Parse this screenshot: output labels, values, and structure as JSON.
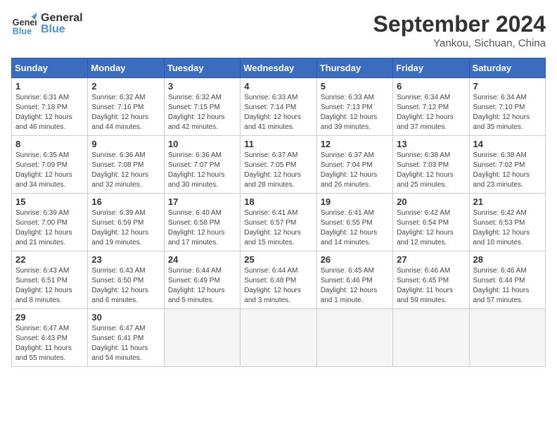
{
  "header": {
    "logo_general": "General",
    "logo_blue": "Blue",
    "month_title": "September 2024",
    "location": "Yankou, Sichuan, China"
  },
  "weekdays": [
    "Sunday",
    "Monday",
    "Tuesday",
    "Wednesday",
    "Thursday",
    "Friday",
    "Saturday"
  ],
  "weeks": [
    [
      {
        "day": "1",
        "info": "Sunrise: 6:31 AM\nSunset: 7:18 PM\nDaylight: 12 hours\nand 46 minutes."
      },
      {
        "day": "2",
        "info": "Sunrise: 6:32 AM\nSunset: 7:16 PM\nDaylight: 12 hours\nand 44 minutes."
      },
      {
        "day": "3",
        "info": "Sunrise: 6:32 AM\nSunset: 7:15 PM\nDaylight: 12 hours\nand 42 minutes."
      },
      {
        "day": "4",
        "info": "Sunrise: 6:33 AM\nSunset: 7:14 PM\nDaylight: 12 hours\nand 41 minutes."
      },
      {
        "day": "5",
        "info": "Sunrise: 6:33 AM\nSunset: 7:13 PM\nDaylight: 12 hours\nand 39 minutes."
      },
      {
        "day": "6",
        "info": "Sunrise: 6:34 AM\nSunset: 7:12 PM\nDaylight: 12 hours\nand 37 minutes."
      },
      {
        "day": "7",
        "info": "Sunrise: 6:34 AM\nSunset: 7:10 PM\nDaylight: 12 hours\nand 35 minutes."
      }
    ],
    [
      {
        "day": "8",
        "info": "Sunrise: 6:35 AM\nSunset: 7:09 PM\nDaylight: 12 hours\nand 34 minutes."
      },
      {
        "day": "9",
        "info": "Sunrise: 6:36 AM\nSunset: 7:08 PM\nDaylight: 12 hours\nand 32 minutes."
      },
      {
        "day": "10",
        "info": "Sunrise: 6:36 AM\nSunset: 7:07 PM\nDaylight: 12 hours\nand 30 minutes."
      },
      {
        "day": "11",
        "info": "Sunrise: 6:37 AM\nSunset: 7:05 PM\nDaylight: 12 hours\nand 28 minutes."
      },
      {
        "day": "12",
        "info": "Sunrise: 6:37 AM\nSunset: 7:04 PM\nDaylight: 12 hours\nand 26 minutes."
      },
      {
        "day": "13",
        "info": "Sunrise: 6:38 AM\nSunset: 7:03 PM\nDaylight: 12 hours\nand 25 minutes."
      },
      {
        "day": "14",
        "info": "Sunrise: 6:38 AM\nSunset: 7:02 PM\nDaylight: 12 hours\nand 23 minutes."
      }
    ],
    [
      {
        "day": "15",
        "info": "Sunrise: 6:39 AM\nSunset: 7:00 PM\nDaylight: 12 hours\nand 21 minutes."
      },
      {
        "day": "16",
        "info": "Sunrise: 6:39 AM\nSunset: 6:59 PM\nDaylight: 12 hours\nand 19 minutes."
      },
      {
        "day": "17",
        "info": "Sunrise: 6:40 AM\nSunset: 6:58 PM\nDaylight: 12 hours\nand 17 minutes."
      },
      {
        "day": "18",
        "info": "Sunrise: 6:41 AM\nSunset: 6:57 PM\nDaylight: 12 hours\nand 15 minutes."
      },
      {
        "day": "19",
        "info": "Sunrise: 6:41 AM\nSunset: 6:55 PM\nDaylight: 12 hours\nand 14 minutes."
      },
      {
        "day": "20",
        "info": "Sunrise: 6:42 AM\nSunset: 6:54 PM\nDaylight: 12 hours\nand 12 minutes."
      },
      {
        "day": "21",
        "info": "Sunrise: 6:42 AM\nSunset: 6:53 PM\nDaylight: 12 hours\nand 10 minutes."
      }
    ],
    [
      {
        "day": "22",
        "info": "Sunrise: 6:43 AM\nSunset: 6:51 PM\nDaylight: 12 hours\nand 8 minutes."
      },
      {
        "day": "23",
        "info": "Sunrise: 6:43 AM\nSunset: 6:50 PM\nDaylight: 12 hours\nand 6 minutes."
      },
      {
        "day": "24",
        "info": "Sunrise: 6:44 AM\nSunset: 6:49 PM\nDaylight: 12 hours\nand 5 minutes."
      },
      {
        "day": "25",
        "info": "Sunrise: 6:44 AM\nSunset: 6:48 PM\nDaylight: 12 hours\nand 3 minutes."
      },
      {
        "day": "26",
        "info": "Sunrise: 6:45 AM\nSunset: 6:46 PM\nDaylight: 12 hours\nand 1 minute."
      },
      {
        "day": "27",
        "info": "Sunrise: 6:46 AM\nSunset: 6:45 PM\nDaylight: 11 hours\nand 59 minutes."
      },
      {
        "day": "28",
        "info": "Sunrise: 6:46 AM\nSunset: 6:44 PM\nDaylight: 11 hours\nand 57 minutes."
      }
    ],
    [
      {
        "day": "29",
        "info": "Sunrise: 6:47 AM\nSunset: 6:43 PM\nDaylight: 11 hours\nand 55 minutes."
      },
      {
        "day": "30",
        "info": "Sunrise: 6:47 AM\nSunset: 6:41 PM\nDaylight: 11 hours\nand 54 minutes."
      },
      {
        "day": "",
        "info": ""
      },
      {
        "day": "",
        "info": ""
      },
      {
        "day": "",
        "info": ""
      },
      {
        "day": "",
        "info": ""
      },
      {
        "day": "",
        "info": ""
      }
    ]
  ]
}
